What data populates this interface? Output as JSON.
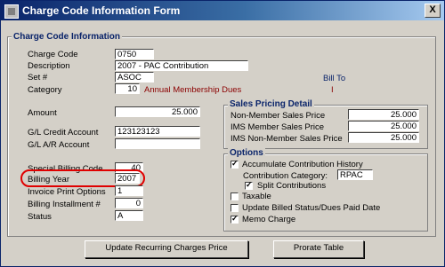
{
  "window": {
    "title": "Charge Code Information Form",
    "close_glyph": "X",
    "app_icon": "form-icon"
  },
  "charge_code_info": {
    "title": "Charge Code Information",
    "charge_code": {
      "label": "Charge Code",
      "value": "0750"
    },
    "description": {
      "label": "Description",
      "value": "2007 - PAC Contribution"
    },
    "set_no": {
      "label": "Set #",
      "value": "ASOC"
    },
    "bill_to": {
      "label": "Bill To",
      "value": "I"
    },
    "category": {
      "label": "Category",
      "value": "10",
      "text": "Annual Membership Dues"
    },
    "amount": {
      "label": "Amount",
      "value": "25.000"
    },
    "gl_credit": {
      "label": "G/L Credit Account",
      "value": "123123123"
    },
    "gl_ar": {
      "label": "G/L  A/R Account",
      "value": ""
    },
    "special_billing": {
      "label": "Special Billing Code",
      "value": "40"
    },
    "billing_year": {
      "label": "Billing Year",
      "value": "2007"
    },
    "invoice_print": {
      "label": "Invoice Print Options",
      "value": "1"
    },
    "billing_installment": {
      "label": "Billing Installment #",
      "value": "0"
    },
    "status": {
      "label": "Status",
      "value": "A"
    }
  },
  "sales_pricing": {
    "title": "Sales Pricing Detail",
    "non_member": {
      "label": "Non-Member Sales Price",
      "value": "25.000"
    },
    "ims_member": {
      "label": "IMS Member Sales Price",
      "value": "25.000"
    },
    "ims_non_member": {
      "label": "IMS Non-Member Sales Price",
      "value": "25.000"
    }
  },
  "options": {
    "title": "Options",
    "accumulate": {
      "label": "Accumulate Contribution History",
      "checked": true
    },
    "contribution_category": {
      "label": "Contribution Category:",
      "value": "RPAC"
    },
    "split": {
      "label": "Split Contributions",
      "checked": true
    },
    "taxable": {
      "label": "Taxable",
      "checked": false
    },
    "update_billed": {
      "label": "Update Billed Status/Dues Paid Date",
      "checked": false
    },
    "memo_charge": {
      "label": "Memo Charge",
      "checked": true
    }
  },
  "buttons": {
    "update_recurring": "Update Recurring Charges Price",
    "prorate": "Prorate Table"
  },
  "colors": {
    "title_gradient_start": "#0a246a",
    "title_gradient_end": "#a6caf0",
    "group_title": "#0a246a",
    "highlight": "#e00000",
    "category_text": "#8b0000"
  }
}
